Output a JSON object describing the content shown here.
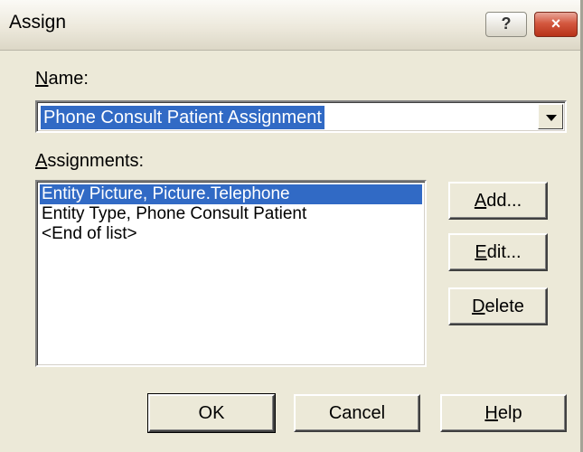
{
  "window": {
    "title": "Assign",
    "help_glyph": "?",
    "close_glyph": "×"
  },
  "name_field": {
    "label": "Name:",
    "value": "Phone Consult Patient Assignment"
  },
  "assignments": {
    "label": "Assignments:",
    "items": [
      {
        "text": "Entity Picture, Picture.Telephone",
        "selected": true
      },
      {
        "text": "Entity Type, Phone Consult Patient",
        "selected": false
      },
      {
        "text": "<End of list>",
        "selected": false
      }
    ]
  },
  "side_buttons": {
    "add": "Add...",
    "edit": "Edit...",
    "delete": "Delete"
  },
  "footer_buttons": {
    "ok": "OK",
    "cancel": "Cancel",
    "help": "Help"
  },
  "colors": {
    "dialog_bg": "#ece9d8",
    "selection": "#316ac5"
  }
}
